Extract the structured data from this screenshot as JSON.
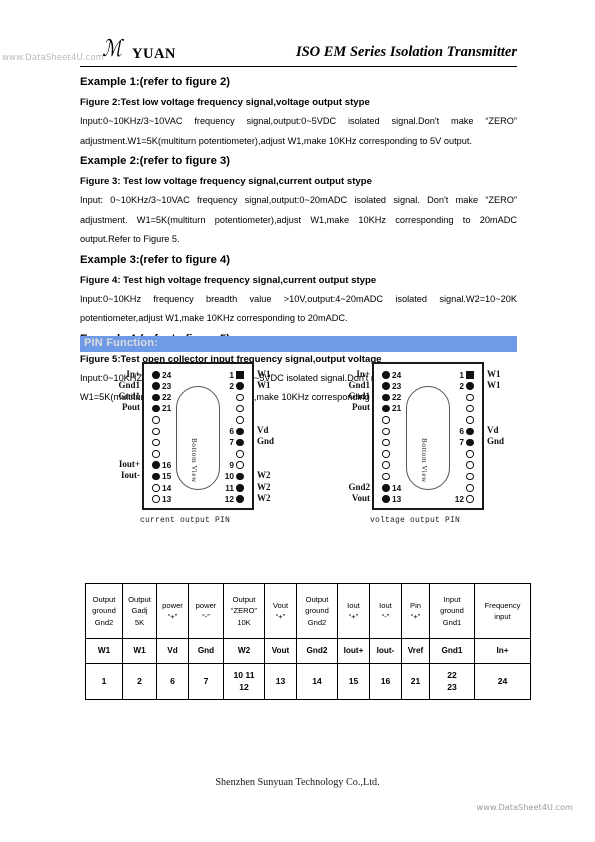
{
  "header": {
    "logo_glyph": "ℳ",
    "brand": "YUAN",
    "title": "ISO EM Series Isolation Transmitter",
    "watermark": "www.DataSheet4U.com"
  },
  "sections": [
    {
      "example_title": "Example 1:(refer to figure 2)",
      "figure_title": "Figure 2:Test low voltage frequency signal,voltage output stype",
      "body": "Input:0~10KHz/3~10VAC frequency signal,output:0~5VDC isolated signal.Don't make “ZERO” adjustment.W1=5K(multiturn potentiometer),adjust W1,make 10KHz corresponding to 5V output."
    },
    {
      "example_title": "Example 2:(refer to figure 3)",
      "figure_title": "Figure 3: Test low voltage frequency signal,current output stype",
      "body": "Input: 0~10KHz/3~10VAC frequency signal,output:0~20mADC isolated signal. Don't make “ZERO” adjustment. W1=5K(multiturn potentiometer),adjust W1,make 10KHz corresponding to 20mADC output.Refer to Figure 5."
    },
    {
      "example_title": "Example 3:(refer to figure 4)",
      "figure_title": "Figure 4: Test high voltage frequency signal,current output stype",
      "body": "Input:0~10KHz frequency breadth value >10V,output:4~20mADC isolated signal.W2=10~20K potentiometer,adjust W1,make 10KHz corresponding to 20mADC."
    },
    {
      "example_title": "Example 4:(refer to figure 5)",
      "figure_title": "Figure 5:Test open collector input frequency signal,output voltage",
      "body": "Input:0~10KHZC frequency signal,output:0~5VDC isolated signal.Don't need “ZERO”adjustment. W1=5K(multiturn potentiometer),adjust W1,make 10KHz corresponding to 5V output."
    }
  ],
  "pin_section": {
    "bar_label": "PIN Function:",
    "bar_color": "#6f9ae8",
    "bar_text_color": "#dcdcdc"
  },
  "diagrams": [
    {
      "caption": "current output PIN",
      "inner_label": "Bottom View",
      "left_pins": [
        {
          "num": "24",
          "label": "In+",
          "style": "filled"
        },
        {
          "num": "23",
          "label": "Gnd1",
          "style": "filled"
        },
        {
          "num": "22",
          "label": "Gnd1",
          "style": "filled"
        },
        {
          "num": "21",
          "label": "Pout",
          "style": "filled"
        },
        {
          "num": "",
          "label": "",
          "style": "open"
        },
        {
          "num": "",
          "label": "",
          "style": "open"
        },
        {
          "num": "",
          "label": "",
          "style": "open"
        },
        {
          "num": "",
          "label": "",
          "style": "open"
        },
        {
          "num": "16",
          "label": "Iout+",
          "style": "filled"
        },
        {
          "num": "15",
          "label": "Iout-",
          "style": "filled"
        },
        {
          "num": "14",
          "label": "",
          "style": "open"
        },
        {
          "num": "13",
          "label": "",
          "style": "open"
        }
      ],
      "right_pins": [
        {
          "num": "1",
          "label": "W1",
          "style": "square"
        },
        {
          "num": "2",
          "label": "W1",
          "style": "filled"
        },
        {
          "num": "",
          "label": "",
          "style": "open"
        },
        {
          "num": "",
          "label": "",
          "style": "open"
        },
        {
          "num": "",
          "label": "",
          "style": "open"
        },
        {
          "num": "6",
          "label": "Vd",
          "style": "filled"
        },
        {
          "num": "7",
          "label": "Gnd",
          "style": "filled"
        },
        {
          "num": "",
          "label": "",
          "style": "open"
        },
        {
          "num": "9",
          "label": "",
          "style": "open"
        },
        {
          "num": "10",
          "label": "W2",
          "style": "filled"
        },
        {
          "num": "11",
          "label": "W2",
          "style": "filled"
        },
        {
          "num": "12",
          "label": "W2",
          "style": "filled"
        }
      ]
    },
    {
      "caption": "voltage output PIN",
      "inner_label": "Bottom View",
      "left_pins": [
        {
          "num": "24",
          "label": "In+",
          "style": "filled"
        },
        {
          "num": "23",
          "label": "Gnd1",
          "style": "filled"
        },
        {
          "num": "22",
          "label": "Gnd1",
          "style": "filled"
        },
        {
          "num": "21",
          "label": "Pout",
          "style": "filled"
        },
        {
          "num": "",
          "label": "",
          "style": "open"
        },
        {
          "num": "",
          "label": "",
          "style": "open"
        },
        {
          "num": "",
          "label": "",
          "style": "open"
        },
        {
          "num": "",
          "label": "",
          "style": "open"
        },
        {
          "num": "",
          "label": "",
          "style": "open"
        },
        {
          "num": "",
          "label": "",
          "style": "open"
        },
        {
          "num": "14",
          "label": "Gnd2",
          "style": "filled"
        },
        {
          "num": "13",
          "label": "Vout",
          "style": "filled"
        }
      ],
      "right_pins": [
        {
          "num": "1",
          "label": "W1",
          "style": "square"
        },
        {
          "num": "2",
          "label": "W1",
          "style": "filled"
        },
        {
          "num": "",
          "label": "",
          "style": "open"
        },
        {
          "num": "",
          "label": "",
          "style": "open"
        },
        {
          "num": "",
          "label": "",
          "style": "open"
        },
        {
          "num": "6",
          "label": "Vd",
          "style": "filled"
        },
        {
          "num": "7",
          "label": "Gnd",
          "style": "filled"
        },
        {
          "num": "",
          "label": "",
          "style": "open"
        },
        {
          "num": "",
          "label": "",
          "style": "open"
        },
        {
          "num": "",
          "label": "",
          "style": "open"
        },
        {
          "num": "",
          "label": "",
          "style": "open"
        },
        {
          "num": "12",
          "label": "",
          "style": "open"
        }
      ]
    }
  ],
  "pin_table": {
    "rows": [
      [
        "Output\nground\nGnd2",
        "Output\nGadj\n5K",
        "power\n“+”",
        "power\n“-”",
        "Output\n“ZERO”\n10K",
        "Vout\n“+”",
        "Output\nground\nGnd2",
        "Iout\n“+”",
        "Iout\n“-”",
        "Pin\n“+”",
        "Input\nground\nGnd1",
        "Frequency\ninput"
      ],
      [
        "W1",
        "W1",
        "Vd",
        "Gnd",
        "W2",
        "Vout",
        "Gnd2",
        "Iout+",
        "Iout-",
        "Vref",
        "Gnd1",
        "In+"
      ],
      [
        "1",
        "2",
        "6",
        "7",
        "10 11\n12",
        "13",
        "14",
        "15",
        "16",
        "21",
        "22\n23",
        "24"
      ]
    ]
  },
  "footer": {
    "company": "Shenzhen Sunyuan Technology Co.,Ltd.",
    "watermark": "www.DataSheet4U.com"
  }
}
